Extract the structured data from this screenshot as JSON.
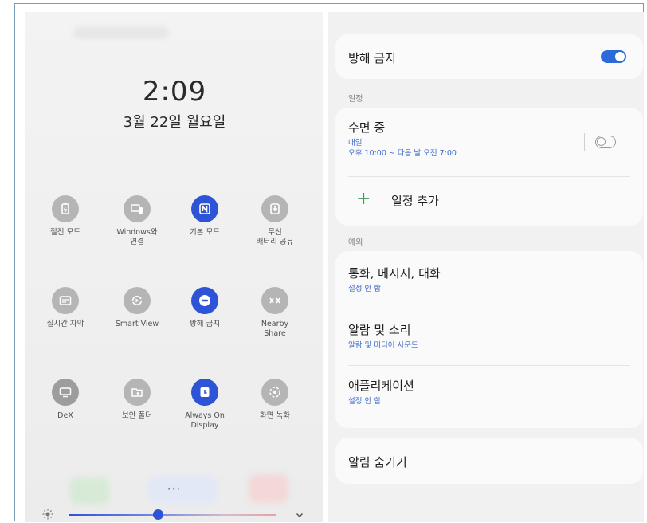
{
  "left_panel": {
    "clock": "2:09",
    "date": "3월 22일 월요일",
    "tiles": [
      {
        "label": "절전 모드",
        "active": false
      },
      {
        "label": "Windows와\n연결",
        "active": false
      },
      {
        "label": "기본 모드",
        "active": true
      },
      {
        "label": "무선\n배터리 공유",
        "active": false
      },
      {
        "label": "실시간 자막",
        "active": false
      },
      {
        "label": "Smart View",
        "active": false
      },
      {
        "label": "방해 금지",
        "active": true
      },
      {
        "label": "Nearby\nShare",
        "active": false
      },
      {
        "label": "DeX",
        "active": false
      },
      {
        "label": "보안 폴더",
        "active": false
      },
      {
        "label": "Always On\nDisplay",
        "active": true
      },
      {
        "label": "화면 녹화",
        "active": false
      }
    ],
    "page_dots": "···",
    "brightness": {
      "level": 0.43
    }
  },
  "right_panel": {
    "dnd": {
      "label": "방해 금지",
      "enabled": true
    },
    "schedule_section": "일정",
    "sleep": {
      "title": "수면 중",
      "repeat": "매일",
      "time": "오후 10:00 ~ 다음 날 오전 7:00",
      "enabled": false
    },
    "add_schedule": "일정 추가",
    "exceptions_section": "예외",
    "exceptions": [
      {
        "title": "통화, 메시지, 대화",
        "sub": "설정 안 함"
      },
      {
        "title": "알람 및 소리",
        "sub": "알람 및 미디어 사운드"
      },
      {
        "title": "애플리케이션",
        "sub": "설정 안 함"
      }
    ],
    "hide_notifications": "알림 숨기기"
  },
  "colors": {
    "accent": "#2d53d7",
    "toggle_on": "#2d6ad9",
    "link": "#3c6ccf",
    "add_plus": "#3f9a4f"
  }
}
